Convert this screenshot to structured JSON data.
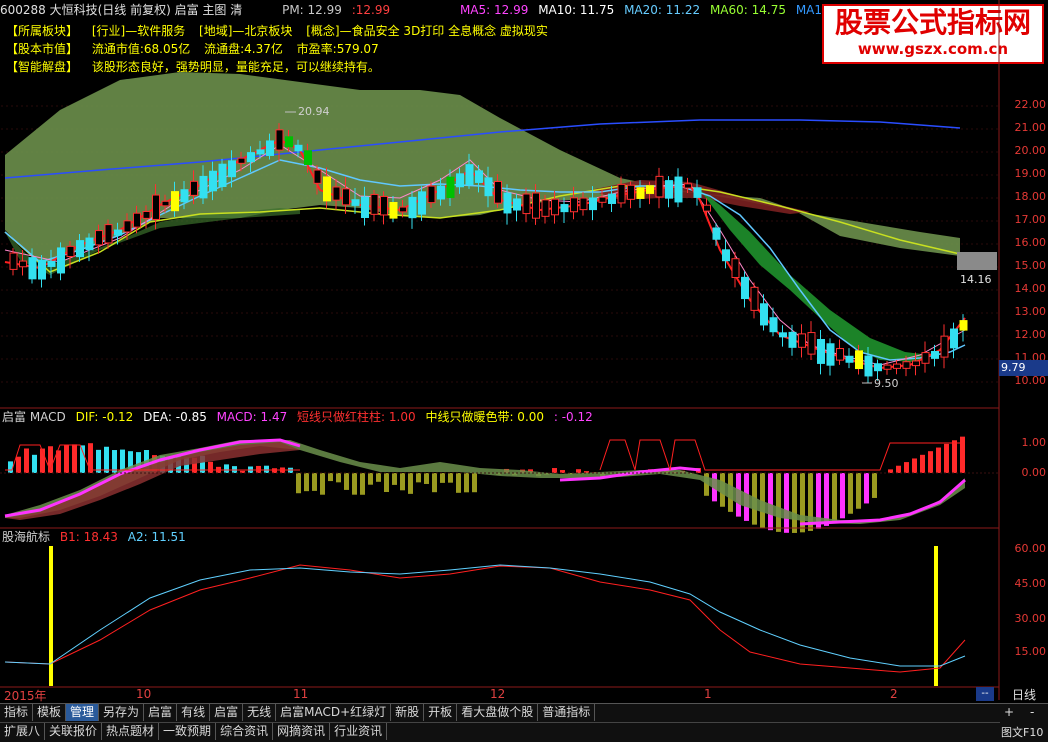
{
  "title_bar": {
    "stock": "600288 大恒科技(日线 前复权) 启富 主图 清",
    "pm": "PM: 12.99",
    "pm2": ":12.99",
    "ma5": "MA5: 12.99",
    "ma10": "MA10: 11.75",
    "ma20": "MA20: 11.22",
    "ma60": "MA60: 14.75",
    "ma120": "MA12"
  },
  "info": {
    "row1_label": "【所属板块】",
    "row1_items": [
      "[行业]—软件服务",
      "[地域]—北京板块",
      "[概念]—食品安全 3D打印 全息概念 虚拟现实"
    ],
    "row2_label": "【股本市值】",
    "row2_items": [
      "流通市值:68.05亿",
      "流通盘:4.37亿",
      "市盈率:579.07"
    ],
    "row3_label": "【智能解盘】",
    "row3_text": "该股形态良好，强势明显，量能充足，可以继续持有。"
  },
  "watermark": {
    "title": "股票公式指标网",
    "url": "www.gszx.com.cn"
  },
  "main_axis": [
    "22.00",
    "21.00",
    "20.00",
    "19.00",
    "18.00",
    "17.00",
    "16.00",
    "15.00",
    "14.00",
    "13.00",
    "12.00",
    "11.00",
    "10.00"
  ],
  "price_tags": {
    "high": "20.94",
    "low": "9.50",
    "current": "14.16",
    "current_box": "9.79"
  },
  "macd": {
    "name": "启富 MACD",
    "dif": "DIF: -0.12",
    "dea": "DEA: -0.85",
    "macd": "MACD: 1.47",
    "short": "短线只做红柱柱: 1.00",
    "mid": "中线只做暖色带: 0.00",
    "last": ": -0.12",
    "axis": [
      "1.00",
      "0.00"
    ]
  },
  "hang": {
    "name": "股海航标",
    "b1": "B1: 18.43",
    "a2": "A2: 11.51",
    "axis": [
      "60.00",
      "45.00",
      "30.00",
      "15.00"
    ]
  },
  "time_axis": {
    "labels": [
      "2015年",
      "10",
      "11",
      "12",
      "1",
      "2"
    ],
    "right_btn": "--",
    "period": "日线"
  },
  "toolbar": {
    "row1": [
      "指标",
      "模板",
      "管理",
      "另存为",
      "启富",
      "有线",
      "启富",
      "无线",
      "启富MACD+红绿灯",
      "新股",
      "开板",
      "看大盘做个股",
      "普通指标"
    ],
    "row1_active": 2,
    "row2": [
      "扩展八",
      "关联报价",
      "热点题材",
      "一致预期",
      "综合资讯",
      "网摘资讯",
      "行业资讯"
    ],
    "right_plus": "+",
    "right_minus": "-",
    "f10": "图文F10"
  },
  "colors": {
    "up": "#ff2a2a",
    "down": "#33e0f0",
    "yellow": "#ffff00",
    "green": "#00c000",
    "magenta": "#ff33ff"
  }
}
